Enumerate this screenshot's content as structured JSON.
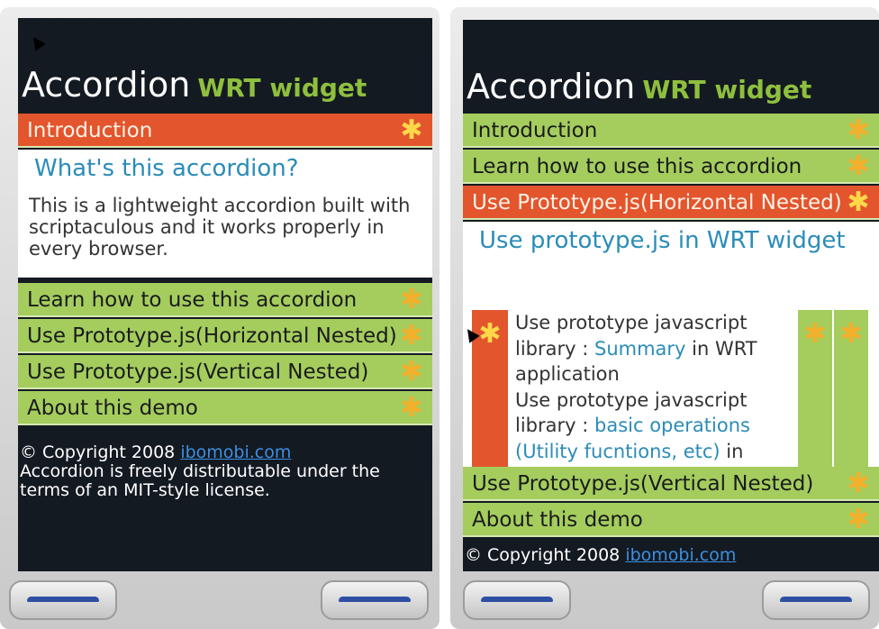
{
  "left": {
    "title": "Accordion",
    "subtitle": "WRT widget",
    "sections": [
      {
        "label": "Introduction",
        "active": true
      },
      {
        "label": "Learn how to use this accordion",
        "active": false
      },
      {
        "label": "Use Prototype.js(Horizontal Nested)",
        "active": false
      },
      {
        "label": "Use Prototype.js(Vertical Nested)",
        "active": false
      },
      {
        "label": "About this demo",
        "active": false
      }
    ],
    "panel": {
      "heading": "What's this accordion?",
      "text": "This is a lightweight accordion built with scriptaculous and it works properly in every browser."
    },
    "footer": {
      "copyright": "© Copyright 2008 ",
      "link": "ibomobi.com",
      "license": "Accordion is freely distributable under the terms of an MIT-style license."
    }
  },
  "right": {
    "title": "Accordion",
    "subtitle": "WRT widget",
    "sections": [
      {
        "label": "Introduction",
        "active": false
      },
      {
        "label": "Learn how to use this accordion",
        "active": false
      },
      {
        "label": "Use Prototype.js(Horizontal Nested)",
        "active": true
      },
      {
        "label": "Use Prototype.js(Vertical Nested)",
        "active": false
      },
      {
        "label": "About this demo",
        "active": false
      }
    ],
    "panel": {
      "heading": "Use prototype.js in WRT widget",
      "line1": "Use prototype javascript library : ",
      "link1": "Summary",
      "line1b": " in WRT application",
      "line2": "Use prototype javascript library : ",
      "link2": "basic operations (Utility fucntions, etc)",
      "line2b": " in WRT application"
    },
    "footer": {
      "copyright": "© Copyright 2008 ",
      "link": "ibomobi.com"
    }
  },
  "icons": {
    "star": "✱"
  },
  "colors": {
    "active": "#e3552d",
    "inactive": "#a4cd5e",
    "screen": "#141a22",
    "subtitle": "#8ebf3e"
  }
}
